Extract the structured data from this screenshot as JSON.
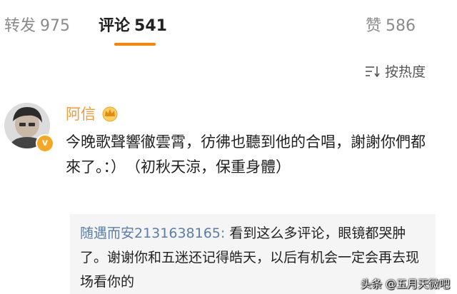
{
  "tabs": {
    "repost": {
      "label": "转发",
      "count": "975"
    },
    "comment": {
      "label": "评论",
      "count": "541"
    },
    "like": {
      "label": "赞",
      "count": "586"
    }
  },
  "sort": {
    "label": "按热度",
    "icon": "sort-icon"
  },
  "comment": {
    "user": "阿信",
    "avatar_badge": "v",
    "text": "今晚歌聲響徹雲霄，彷彿也聽到他的合唱，謝謝你們都來了。：）　（初秋天涼，保重身體）"
  },
  "reply": {
    "user": "随遇而安2131638165:",
    "text": " 看到这么多评论，眼镜都哭肿了。谢谢你和五迷还记得皓天，以后有机会一定会再去现场看你的"
  },
  "watermark": "头条 @五月天微吧",
  "colors": {
    "accent": "#ff8200",
    "username": "#f09a38",
    "reply_user": "#5a7ea8"
  }
}
